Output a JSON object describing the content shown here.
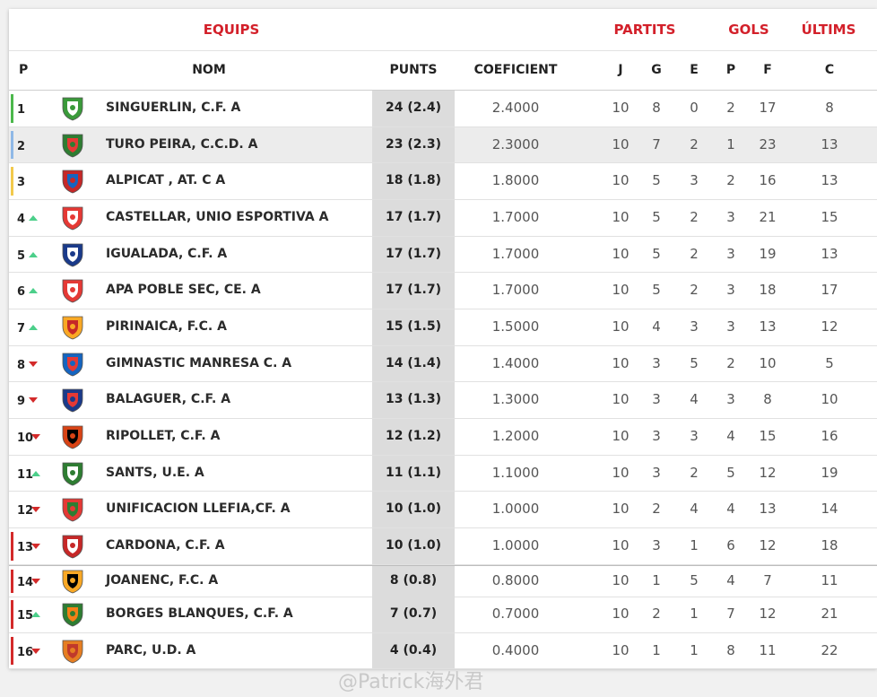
{
  "header": {
    "group_equips": "EQUIPS",
    "group_partits": "PARTITS",
    "group_gols": "GOLS",
    "group_ultims": "ÚLTIMS",
    "col_p": "P",
    "col_nom": "NOM",
    "col_punts": "PUNTS",
    "col_coef": "COEFICIENT",
    "col_j": "J",
    "col_g": "G",
    "col_e": "E",
    "col_pp": "P",
    "col_f": "F",
    "col_c": "C"
  },
  "colors": {
    "accent": "#d3202a",
    "up": "#4ccf8a",
    "down": "#d32a2a",
    "promo": "#4cb84c",
    "playoff": "#8fb8e6",
    "yellow": "#f2c94c",
    "relegation": "#d32a2a"
  },
  "rows": [
    {
      "pos": "1",
      "trend": "none",
      "zone": "promo",
      "crest": "singuerlin-crest",
      "name": "SINGUERLIN, C.F. A",
      "punts": "24 (2.4)",
      "coef": "2.4000",
      "j": "10",
      "g": "8",
      "e": "0",
      "p": "2",
      "f": "17",
      "c": "8"
    },
    {
      "pos": "2",
      "trend": "none",
      "zone": "playoff",
      "crest": "turo-peira-crest",
      "name": "TURO PEIRA, C.C.D. A",
      "punts": "23 (2.3)",
      "coef": "2.3000",
      "j": "10",
      "g": "7",
      "e": "2",
      "p": "1",
      "f": "23",
      "c": "13"
    },
    {
      "pos": "3",
      "trend": "none",
      "zone": "yellow",
      "crest": "alpicat-crest",
      "name": "ALPICAT , AT. C A",
      "punts": "18 (1.8)",
      "coef": "1.8000",
      "j": "10",
      "g": "5",
      "e": "3",
      "p": "2",
      "f": "16",
      "c": "13"
    },
    {
      "pos": "4",
      "trend": "up",
      "zone": "none",
      "crest": "castellar-crest",
      "name": "CASTELLAR, UNIO ESPORTIVA A",
      "punts": "17 (1.7)",
      "coef": "1.7000",
      "j": "10",
      "g": "5",
      "e": "2",
      "p": "3",
      "f": "21",
      "c": "15"
    },
    {
      "pos": "5",
      "trend": "up",
      "zone": "none",
      "crest": "igualada-crest",
      "name": "IGUALADA, C.F. A",
      "punts": "17 (1.7)",
      "coef": "1.7000",
      "j": "10",
      "g": "5",
      "e": "2",
      "p": "3",
      "f": "19",
      "c": "13"
    },
    {
      "pos": "6",
      "trend": "up",
      "zone": "none",
      "crest": "apa-poble-sec-crest",
      "name": "APA POBLE SEC, CE. A",
      "punts": "17 (1.7)",
      "coef": "1.7000",
      "j": "10",
      "g": "5",
      "e": "2",
      "p": "3",
      "f": "18",
      "c": "17"
    },
    {
      "pos": "7",
      "trend": "up",
      "zone": "none",
      "crest": "pirinaica-crest",
      "name": "PIRINAICA, F.C. A",
      "punts": "15 (1.5)",
      "coef": "1.5000",
      "j": "10",
      "g": "4",
      "e": "3",
      "p": "3",
      "f": "13",
      "c": "12"
    },
    {
      "pos": "8",
      "trend": "down",
      "zone": "none",
      "crest": "gimnastic-manresa-crest",
      "name": "GIMNASTIC MANRESA C. A",
      "punts": "14 (1.4)",
      "coef": "1.4000",
      "j": "10",
      "g": "3",
      "e": "5",
      "p": "2",
      "f": "10",
      "c": "5"
    },
    {
      "pos": "9",
      "trend": "down",
      "zone": "none",
      "crest": "balaguer-crest",
      "name": "BALAGUER, C.F. A",
      "punts": "13 (1.3)",
      "coef": "1.3000",
      "j": "10",
      "g": "3",
      "e": "4",
      "p": "3",
      "f": "8",
      "c": "10"
    },
    {
      "pos": "10",
      "trend": "down",
      "zone": "none",
      "crest": "ripollet-crest",
      "name": "RIPOLLET, C.F. A",
      "punts": "12 (1.2)",
      "coef": "1.2000",
      "j": "10",
      "g": "3",
      "e": "3",
      "p": "4",
      "f": "15",
      "c": "16"
    },
    {
      "pos": "11",
      "trend": "up",
      "zone": "none",
      "crest": "sants-crest",
      "name": "SANTS, U.E. A",
      "punts": "11 (1.1)",
      "coef": "1.1000",
      "j": "10",
      "g": "3",
      "e": "2",
      "p": "5",
      "f": "12",
      "c": "19"
    },
    {
      "pos": "12",
      "trend": "down",
      "zone": "none",
      "crest": "unificacion-llefia-crest",
      "name": "UNIFICACION LLEFIA,CF. A",
      "punts": "10 (1.0)",
      "coef": "1.0000",
      "j": "10",
      "g": "2",
      "e": "4",
      "p": "4",
      "f": "13",
      "c": "14"
    },
    {
      "pos": "13",
      "trend": "down",
      "zone": "relegation",
      "crest": "cardona-crest",
      "name": "CARDONA, C.F. A",
      "punts": "10 (1.0)",
      "coef": "1.0000",
      "j": "10",
      "g": "3",
      "e": "1",
      "p": "6",
      "f": "12",
      "c": "18"
    },
    {
      "pos": "14",
      "trend": "down",
      "zone": "relegation",
      "crest": "joanenc-crest",
      "name": "JOANENC, F.C. A",
      "punts": "8 (0.8)",
      "coef": "0.8000",
      "j": "10",
      "g": "1",
      "e": "5",
      "p": "4",
      "f": "7",
      "c": "11"
    },
    {
      "pos": "15",
      "trend": "up",
      "zone": "relegation",
      "crest": "borges-blanques-crest",
      "name": "BORGES BLANQUES, C.F. A",
      "punts": "7 (0.7)",
      "coef": "0.7000",
      "j": "10",
      "g": "2",
      "e": "1",
      "p": "7",
      "f": "12",
      "c": "21"
    },
    {
      "pos": "16",
      "trend": "down",
      "zone": "relegation",
      "crest": "parc-crest",
      "name": "PARC, U.D. A",
      "punts": "4 (0.4)",
      "coef": "0.4000",
      "j": "10",
      "g": "1",
      "e": "1",
      "p": "8",
      "f": "11",
      "c": "22"
    }
  ],
  "watermark": "@Patrick海外君"
}
